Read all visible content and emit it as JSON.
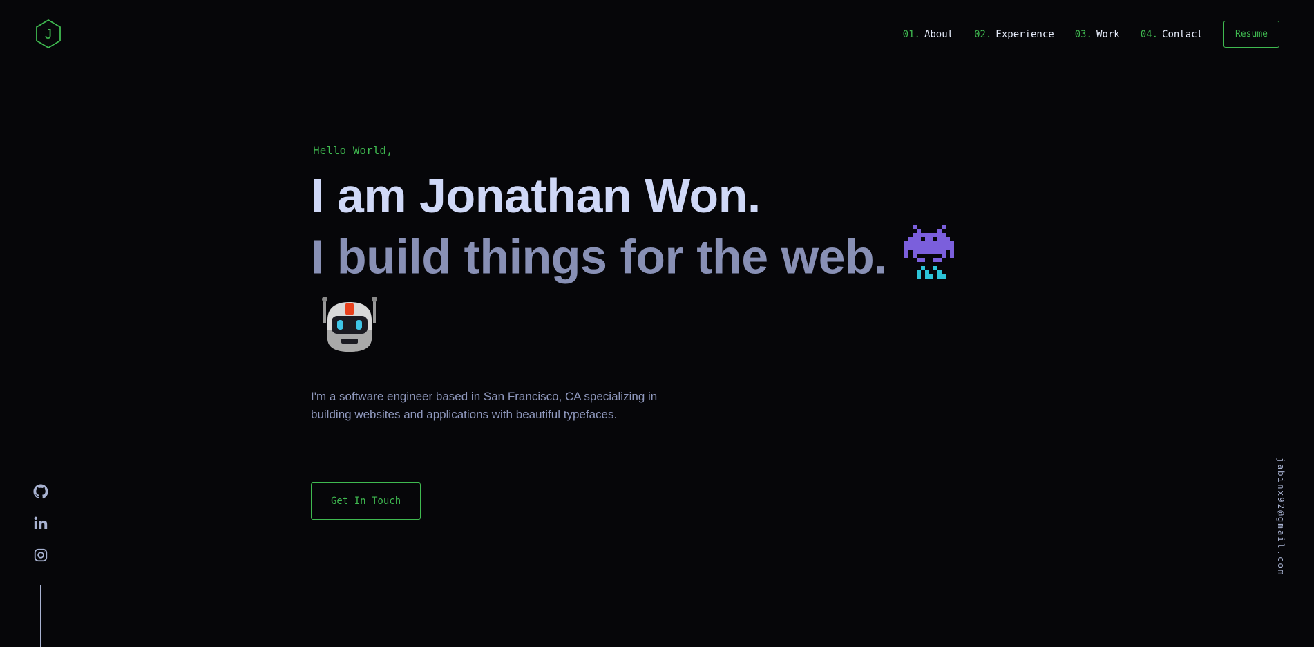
{
  "logo": {
    "letter": "J",
    "icon": "hexagon-logo-icon"
  },
  "nav": {
    "items": [
      {
        "num": "01.",
        "label": "About"
      },
      {
        "num": "02.",
        "label": "Experience"
      },
      {
        "num": "03.",
        "label": "Work"
      },
      {
        "num": "04.",
        "label": "Contact"
      }
    ],
    "resume_label": "Resume"
  },
  "hero": {
    "greeting": "Hello World,",
    "name": "I am Jonathan Won.",
    "tagline": "I build things for the web.",
    "emojis": [
      "alien-monster-icon",
      "robot-icon"
    ],
    "bio": "I'm a software engineer based in San Francisco, CA specializing in building websites and applications with beautiful typefaces.",
    "cta_label": "Get In Touch"
  },
  "social": {
    "icons": [
      "github-icon",
      "linkedin-icon",
      "instagram-icon"
    ]
  },
  "email": "jabinx92@gmail.com",
  "colors": {
    "background": "#060609",
    "accent": "#3fb950",
    "heading": "#cfd8f7",
    "subheading": "#8890b5",
    "text": "#8f98bd"
  }
}
